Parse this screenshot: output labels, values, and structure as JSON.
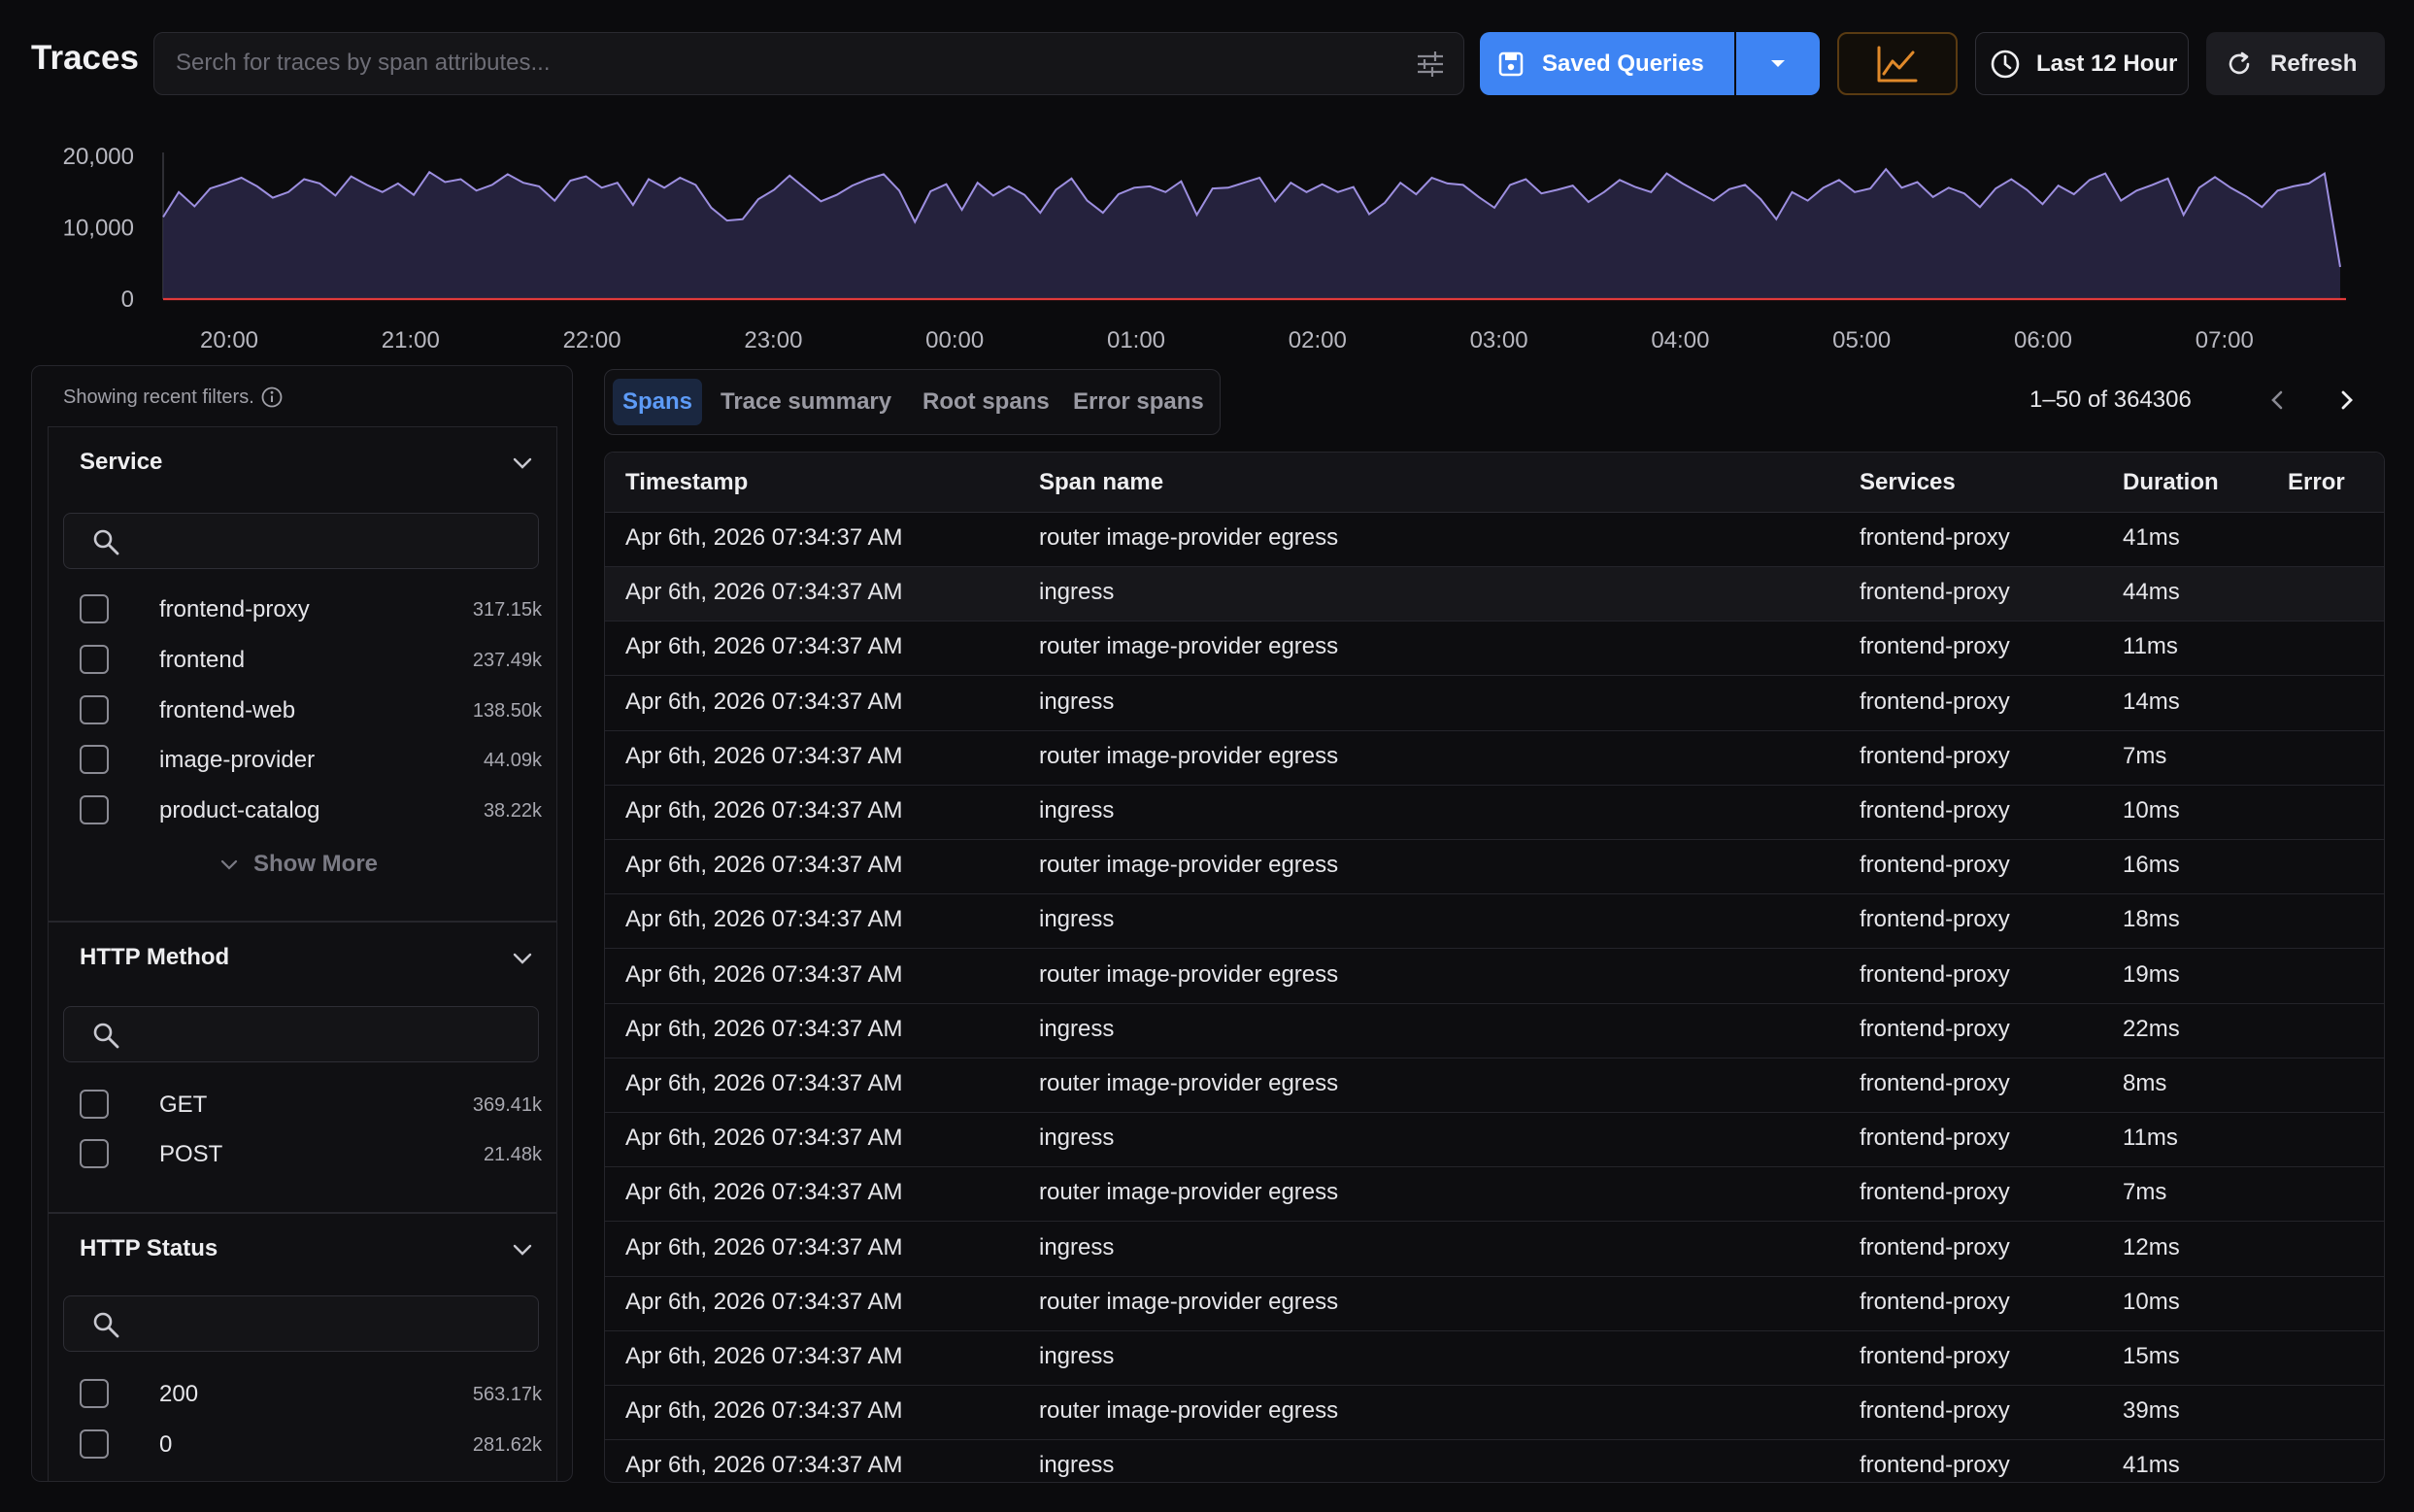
{
  "header": {
    "title": "Traces",
    "search_placeholder": "Serch for traces by span attributes...",
    "saved_queries_label": "Saved Queries",
    "time_range_label": "Last 12 Hour",
    "refresh_label": "Refresh"
  },
  "chart_data": {
    "type": "area",
    "title": "",
    "xlabel": "",
    "ylabel": "",
    "x_tick_labels": [
      "20:00",
      "21:00",
      "22:00",
      "23:00",
      "00:00",
      "01:00",
      "02:00",
      "03:00",
      "04:00",
      "05:00",
      "06:00",
      "07:00"
    ],
    "y_tick_labels": [
      "20,000",
      "10,000",
      "0"
    ],
    "ylim": [
      0,
      20000
    ],
    "series": [
      {
        "color": "#9d8fe0",
        "values": [
          11500,
          15000,
          13000,
          15500,
          16200,
          17000,
          15800,
          14200,
          15000,
          16800,
          16200,
          14500,
          17200,
          16000,
          15000,
          16200,
          14600,
          17800,
          16400,
          16800,
          15200,
          16000,
          17500,
          16300,
          15800,
          13800,
          16600,
          17200,
          15600,
          16300,
          13200,
          16800,
          15600,
          17000,
          16000,
          12800,
          11000,
          11200,
          14000,
          15300,
          17300,
          15500,
          13700,
          14600,
          15900,
          16800,
          17500,
          15200,
          10800,
          15100,
          16100,
          12500,
          16300,
          14500,
          15800,
          14600,
          12100,
          15300,
          16900,
          13800,
          12100,
          14700,
          15600,
          15800,
          15000,
          16500,
          11800,
          15500,
          15600,
          16300,
          17000,
          13700,
          16300,
          15000,
          16100,
          15000,
          15700,
          11900,
          13500,
          16300,
          14700,
          17000,
          16200,
          16000,
          14300,
          12800,
          16000,
          16800,
          14800,
          15300,
          15900,
          13600,
          15000,
          16700,
          15700,
          15000,
          17600,
          16200,
          15000,
          13800,
          15400,
          16000,
          14000,
          11200,
          15000,
          13800,
          15600,
          16700,
          15000,
          15500,
          18200,
          15600,
          16400,
          14300,
          15600,
          14800,
          12900,
          15500,
          16800,
          15300,
          13300,
          15900,
          14700,
          16700,
          17600,
          13800,
          15200,
          16000,
          16900,
          11800,
          15600,
          17100,
          15600,
          14400,
          12900,
          15200,
          15800,
          16200,
          17600,
          4500
        ]
      }
    ],
    "threshold_line": {
      "value": 0,
      "color": "#e03a3a"
    },
    "grid": false
  },
  "filters": {
    "note": "Showing recent filters.",
    "show_more_label": "Show More",
    "groups": [
      {
        "title": "Service",
        "options": [
          {
            "label": "frontend-proxy",
            "count": "317.15k"
          },
          {
            "label": "frontend",
            "count": "237.49k"
          },
          {
            "label": "frontend-web",
            "count": "138.50k"
          },
          {
            "label": "image-provider",
            "count": "44.09k"
          },
          {
            "label": "product-catalog",
            "count": "38.22k"
          }
        ]
      },
      {
        "title": "HTTP Method",
        "options": [
          {
            "label": "GET",
            "count": "369.41k"
          },
          {
            "label": "POST",
            "count": "21.48k"
          }
        ]
      },
      {
        "title": "HTTP Status",
        "options": [
          {
            "label": "200",
            "count": "563.17k"
          },
          {
            "label": "0",
            "count": "281.62k"
          }
        ]
      }
    ]
  },
  "tabs": [
    "Spans",
    "Trace summary",
    "Root spans",
    "Error spans"
  ],
  "active_tab": "Spans",
  "pagination": {
    "label": "1–50 of 364306"
  },
  "table": {
    "columns": [
      "Timestamp",
      "Span name",
      "Services",
      "Duration",
      "Error"
    ],
    "rows": [
      {
        "timestamp": "Apr 6th, 2026 07:34:37 AM",
        "span": "router image-provider egress",
        "service": "frontend-proxy",
        "duration": "41ms",
        "error": ""
      },
      {
        "timestamp": "Apr 6th, 2026 07:34:37 AM",
        "span": "ingress",
        "service": "frontend-proxy",
        "duration": "44ms",
        "error": ""
      },
      {
        "timestamp": "Apr 6th, 2026 07:34:37 AM",
        "span": "router image-provider egress",
        "service": "frontend-proxy",
        "duration": "11ms",
        "error": ""
      },
      {
        "timestamp": "Apr 6th, 2026 07:34:37 AM",
        "span": "ingress",
        "service": "frontend-proxy",
        "duration": "14ms",
        "error": ""
      },
      {
        "timestamp": "Apr 6th, 2026 07:34:37 AM",
        "span": "router image-provider egress",
        "service": "frontend-proxy",
        "duration": "7ms",
        "error": ""
      },
      {
        "timestamp": "Apr 6th, 2026 07:34:37 AM",
        "span": "ingress",
        "service": "frontend-proxy",
        "duration": "10ms",
        "error": ""
      },
      {
        "timestamp": "Apr 6th, 2026 07:34:37 AM",
        "span": "router image-provider egress",
        "service": "frontend-proxy",
        "duration": "16ms",
        "error": ""
      },
      {
        "timestamp": "Apr 6th, 2026 07:34:37 AM",
        "span": "ingress",
        "service": "frontend-proxy",
        "duration": "18ms",
        "error": ""
      },
      {
        "timestamp": "Apr 6th, 2026 07:34:37 AM",
        "span": "router image-provider egress",
        "service": "frontend-proxy",
        "duration": "19ms",
        "error": ""
      },
      {
        "timestamp": "Apr 6th, 2026 07:34:37 AM",
        "span": "ingress",
        "service": "frontend-proxy",
        "duration": "22ms",
        "error": ""
      },
      {
        "timestamp": "Apr 6th, 2026 07:34:37 AM",
        "span": "router image-provider egress",
        "service": "frontend-proxy",
        "duration": "8ms",
        "error": ""
      },
      {
        "timestamp": "Apr 6th, 2026 07:34:37 AM",
        "span": "ingress",
        "service": "frontend-proxy",
        "duration": "11ms",
        "error": ""
      },
      {
        "timestamp": "Apr 6th, 2026 07:34:37 AM",
        "span": "router image-provider egress",
        "service": "frontend-proxy",
        "duration": "7ms",
        "error": ""
      },
      {
        "timestamp": "Apr 6th, 2026 07:34:37 AM",
        "span": "ingress",
        "service": "frontend-proxy",
        "duration": "12ms",
        "error": ""
      },
      {
        "timestamp": "Apr 6th, 2026 07:34:37 AM",
        "span": "router image-provider egress",
        "service": "frontend-proxy",
        "duration": "10ms",
        "error": ""
      },
      {
        "timestamp": "Apr 6th, 2026 07:34:37 AM",
        "span": "ingress",
        "service": "frontend-proxy",
        "duration": "15ms",
        "error": ""
      },
      {
        "timestamp": "Apr 6th, 2026 07:34:37 AM",
        "span": "router image-provider egress",
        "service": "frontend-proxy",
        "duration": "39ms",
        "error": ""
      },
      {
        "timestamp": "Apr 6th, 2026 07:34:37 AM",
        "span": "ingress",
        "service": "frontend-proxy",
        "duration": "41ms",
        "error": ""
      }
    ]
  },
  "colors": {
    "accent": "#3e84f3",
    "chart_line": "#9d8fe0",
    "chart_fill": "#2a2747",
    "baseline": "#e03a3a",
    "chart_button_accent": "#e0892a"
  }
}
